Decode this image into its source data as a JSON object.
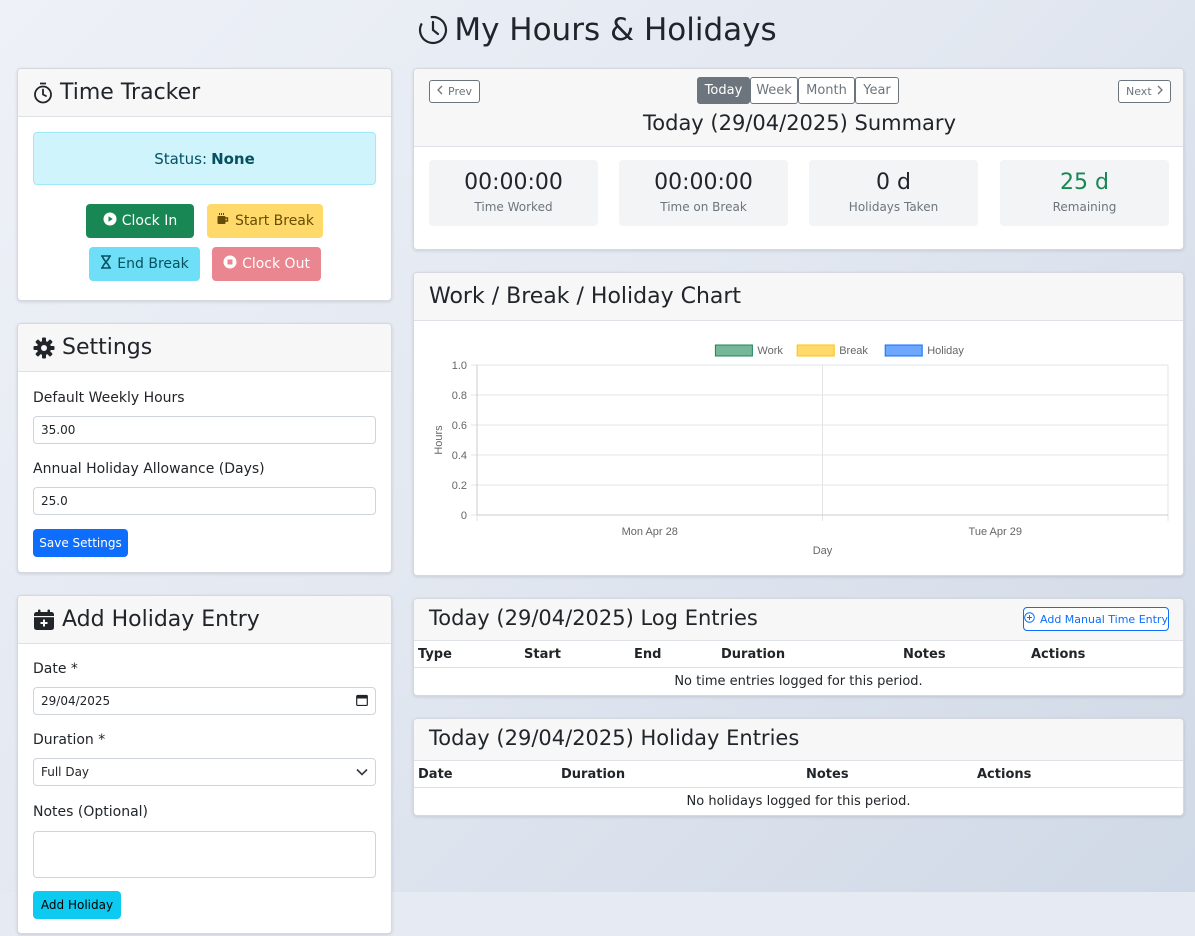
{
  "page": {
    "title": "My Hours & Holidays"
  },
  "time_tracker": {
    "title": "Time Tracker",
    "status_label": "Status:",
    "status_value": "None",
    "clock_in": "Clock In",
    "start_break": "Start Break",
    "end_break": "End Break",
    "clock_out": "Clock Out"
  },
  "settings": {
    "title": "Settings",
    "weekly_hours_label": "Default Weekly Hours",
    "weekly_hours_value": "35.00",
    "allowance_label": "Annual Holiday Allowance (Days)",
    "allowance_value": "25.0",
    "save_label": "Save Settings"
  },
  "add_holiday": {
    "title": "Add Holiday Entry",
    "date_label": "Date *",
    "date_value": "29/04/2025",
    "duration_label": "Duration *",
    "duration_value": "Full Day",
    "notes_label": "Notes (Optional)",
    "notes_value": "",
    "submit_label": "Add Holiday"
  },
  "summary": {
    "prev_label": "Prev",
    "next_label": "Next",
    "periods": [
      "Today",
      "Week",
      "Month",
      "Year"
    ],
    "active_period": "Today",
    "heading": "Today (29/04/2025) Summary",
    "stats": [
      {
        "value": "00:00:00",
        "label": "Time Worked"
      },
      {
        "value": "00:00:00",
        "label": "Time on Break"
      },
      {
        "value": "0 d",
        "label": "Holidays Taken"
      },
      {
        "value": "25 d",
        "label": "Remaining"
      }
    ],
    "remaining_color": "#198754"
  },
  "chart_card": {
    "title": "Work / Break / Holiday Chart"
  },
  "chart_data": {
    "type": "bar",
    "categories": [
      "Mon Apr 28",
      "Tue Apr 29"
    ],
    "series": [
      {
        "name": "Work",
        "values": [
          0,
          0
        ],
        "color": "#198754"
      },
      {
        "name": "Break",
        "values": [
          0,
          0
        ],
        "color": "#ffc107"
      },
      {
        "name": "Holiday",
        "values": [
          0,
          0
        ],
        "color": "#0d6efd"
      }
    ],
    "xlabel": "Day",
    "ylabel": "Hours",
    "ylim": [
      0,
      1.0
    ],
    "yticks": [
      "1.0",
      "0.8",
      "0.6",
      "0.4",
      "0.2",
      "0"
    ],
    "legend_position": "top-center",
    "grid": true
  },
  "log_entries": {
    "title": "Today (29/04/2025) Log Entries",
    "add_label": "Add Manual Time Entry",
    "columns": [
      "Type",
      "Start",
      "End",
      "Duration",
      "Notes",
      "Actions"
    ],
    "empty_text": "No time entries logged for this period."
  },
  "holiday_entries": {
    "title": "Today (29/04/2025) Holiday Entries",
    "columns": [
      "Date",
      "Duration",
      "Notes",
      "Actions"
    ],
    "empty_text": "No holidays logged for this period."
  }
}
